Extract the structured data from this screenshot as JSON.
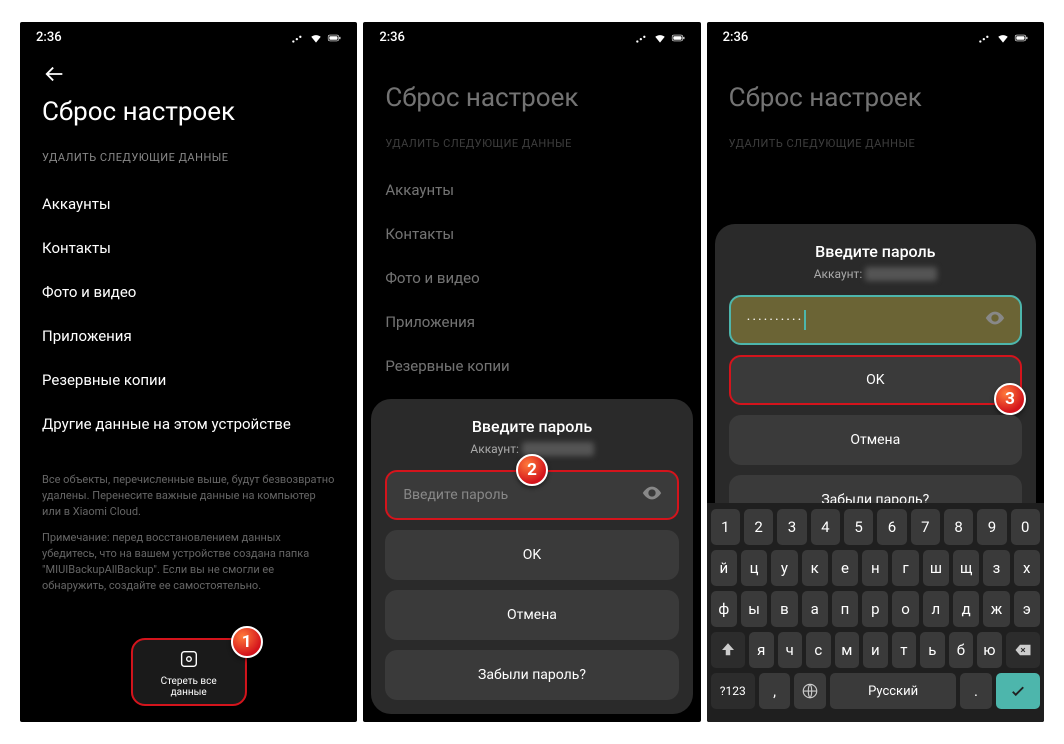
{
  "status": {
    "time": "2:36"
  },
  "page": {
    "title": "Сброс настроек",
    "sectionHeader": "УДАЛИТЬ СЛЕДУЮЩИЕ ДАННЫЕ",
    "items": [
      "Аккаунты",
      "Контакты",
      "Фото и видео",
      "Приложения",
      "Резервные копии",
      "Другие данные на этом устройстве"
    ],
    "note1": "Все объекты, перечисленные выше, будут безвозвратно удалены. Перенесите важные данные на компьютер или в Xiaomi Cloud.",
    "note2": "Примечание: перед восстановлением данных убедитесь, что на вашем устройстве создана папка \"MIUIBackupAllBackup\". Если вы не смогли ее обнаружить, создайте ее самостоятельно."
  },
  "eraseBtn": "Стереть все\nданные",
  "modal": {
    "title": "Введите пароль",
    "accountLabel": "Аккаунт:",
    "placeholder": "Введите пароль",
    "dots": "··········",
    "ok": "OK",
    "cancel": "Отмена",
    "forgot": "Забыли пароль?"
  },
  "badges": {
    "b1": "1",
    "b2": "2",
    "b3": "3"
  },
  "keyboard": {
    "row1": [
      "1",
      "2",
      "3",
      "4",
      "5",
      "6",
      "7",
      "8",
      "9",
      "0"
    ],
    "row2": [
      "й",
      "ц",
      "у",
      "к",
      "е",
      "н",
      "г",
      "ш",
      "щ",
      "з",
      "х"
    ],
    "row3": [
      "ф",
      "ы",
      "в",
      "а",
      "п",
      "р",
      "о",
      "л",
      "д",
      "ж",
      "э"
    ],
    "row4": [
      "я",
      "ч",
      "с",
      "м",
      "и",
      "т",
      "ь",
      "б",
      "ю"
    ],
    "sym": "?123",
    "lang": "Русский",
    "comma": ",",
    "period": "."
  }
}
